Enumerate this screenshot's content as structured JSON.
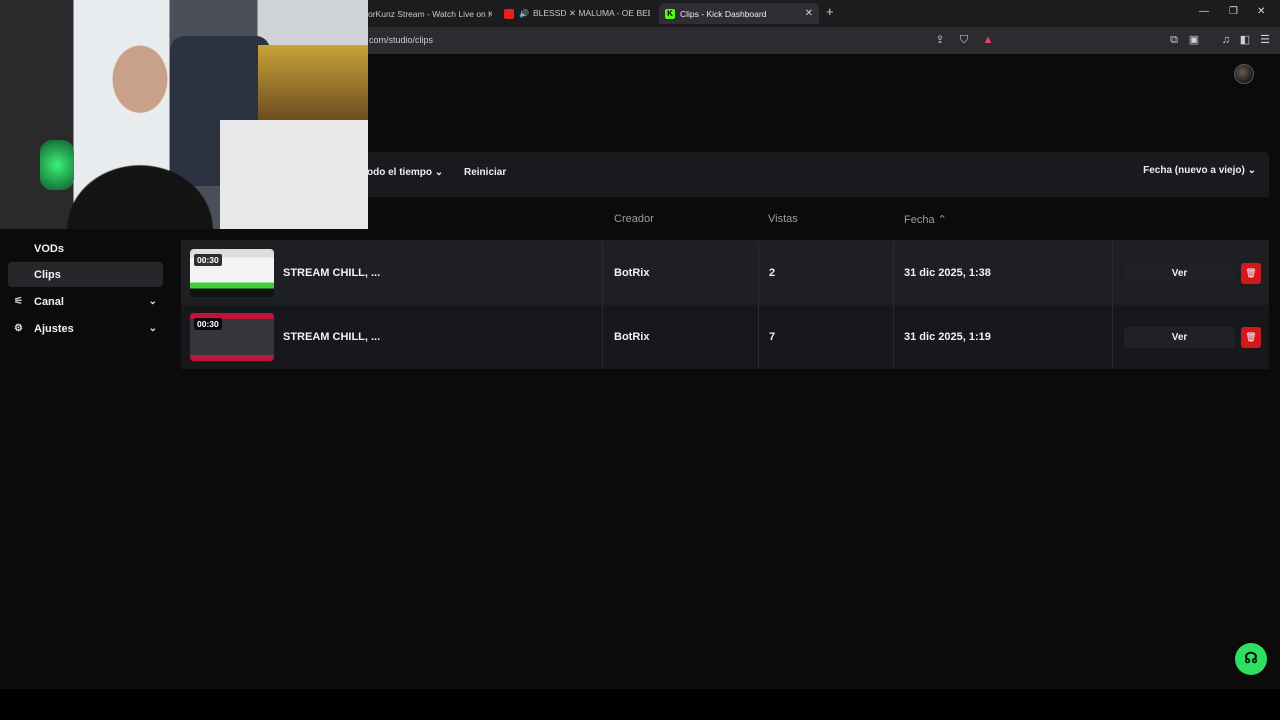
{
  "browser": {
    "tabs": [
      {
        "title": "orKunz Stream - Watch Live on K",
        "active": false
      },
      {
        "title": "BLESSD ✕ MALUMA - OE BEBÉ",
        "active": false
      },
      {
        "title": "Clips - Kick Dashboard",
        "active": true
      }
    ],
    "url": "com/studio/clips",
    "alert_count": "1"
  },
  "sidebar": {
    "items": [
      {
        "label": "VODs",
        "active": false
      },
      {
        "label": "Clips",
        "active": true
      },
      {
        "label": "Canal",
        "icon": "sliders-icon",
        "expandable": true
      },
      {
        "label": "Ajustes",
        "icon": "gear-icon",
        "expandable": true
      }
    ]
  },
  "filters": {
    "time_range": "odo el tiempo",
    "reset": "Reiniciar",
    "sort": "Fecha (nuevo a viejo)"
  },
  "table": {
    "headers": {
      "creator": "Creador",
      "views": "Vistas",
      "date": "Fecha"
    },
    "rows": [
      {
        "duration": "00:30",
        "title": "STREAM CHILL, ...",
        "creator": "BotRix",
        "views": "2",
        "date": "31 dic 2025, 1:38",
        "action": "Ver"
      },
      {
        "duration": "00:30",
        "title": "STREAM CHILL, ...",
        "creator": "BotRix",
        "views": "7",
        "date": "31 dic 2025, 1:19",
        "action": "Ver"
      }
    ]
  },
  "colors": {
    "accent": "#53fc18",
    "delete": "#d4161d",
    "help": "#2ee05f"
  }
}
